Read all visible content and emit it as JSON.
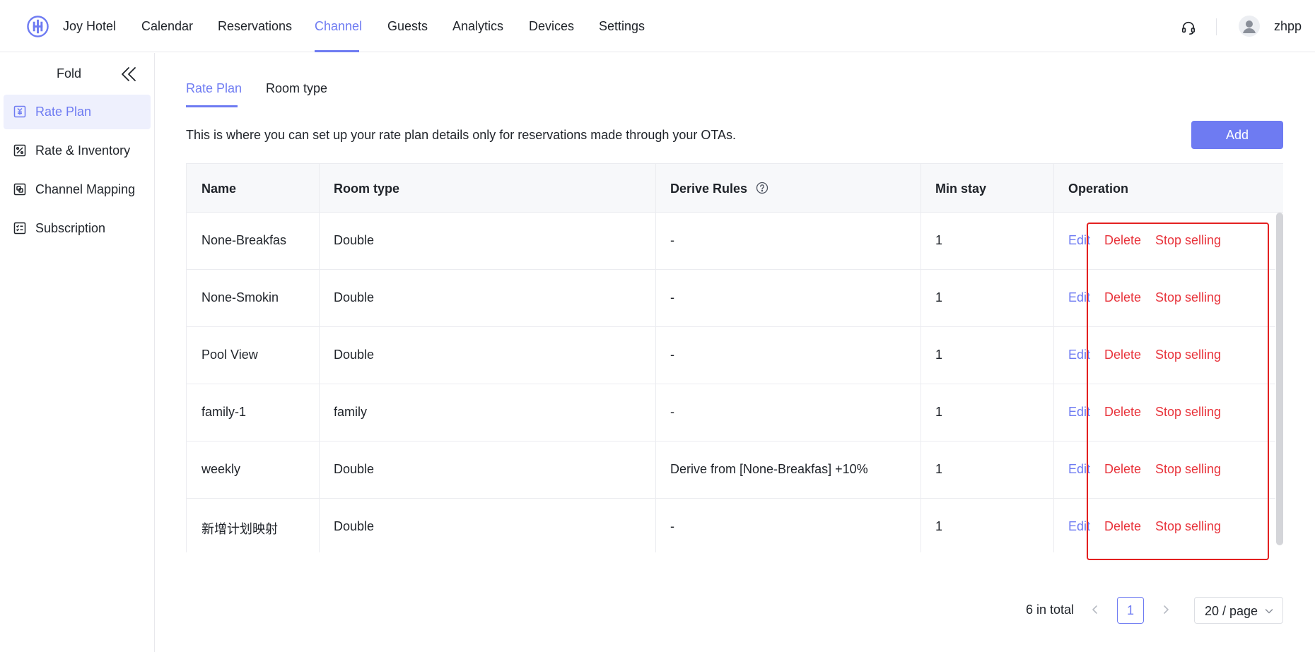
{
  "app": {
    "brand": "Joy Hotel",
    "accent_color": "#6e7bf2",
    "danger_color": "#e8333b",
    "highlight_color": "#e32020"
  },
  "nav": {
    "items": [
      "Calendar",
      "Reservations",
      "Channel",
      "Guests",
      "Analytics",
      "Devices",
      "Settings"
    ],
    "active": "Channel",
    "user": "zhpp"
  },
  "sidebar": {
    "fold_label": "Fold",
    "items": [
      {
        "label": "Rate Plan",
        "icon": "rate-plan-icon",
        "active": true
      },
      {
        "label": "Rate & Inventory",
        "icon": "rate-inventory-icon",
        "active": false
      },
      {
        "label": "Channel Mapping",
        "icon": "channel-mapping-icon",
        "active": false
      },
      {
        "label": "Subscription",
        "icon": "subscription-icon",
        "active": false
      }
    ]
  },
  "main": {
    "tabs": [
      "Rate Plan",
      "Room type"
    ],
    "active_tab": "Rate Plan",
    "description": "This is where you can set up your rate plan details only for reservations made through your OTAs.",
    "add_label": "Add"
  },
  "table": {
    "headers": {
      "name": "Name",
      "room_type": "Room type",
      "derive_rules": "Derive Rules",
      "min_stay": "Min stay",
      "operation": "Operation"
    },
    "rows": [
      {
        "name": "None-Breakfas",
        "room_type": "Double",
        "derive_rules": "-",
        "min_stay": "1",
        "edit": "Edit",
        "delete": "Delete",
        "stop": "Stop selling"
      },
      {
        "name": "None-Smokin",
        "room_type": "Double",
        "derive_rules": "-",
        "min_stay": "1",
        "edit": "Edit",
        "delete": "Delete",
        "stop": "Stop selling"
      },
      {
        "name": "Pool View",
        "room_type": "Double",
        "derive_rules": "-",
        "min_stay": "1",
        "edit": "Edit",
        "delete": "Delete",
        "stop": "Stop selling"
      },
      {
        "name": "family-1",
        "room_type": "family",
        "derive_rules": "-",
        "min_stay": "1",
        "edit": "Edit",
        "delete": "Delete",
        "stop": "Stop selling"
      },
      {
        "name": "weekly",
        "room_type": "Double",
        "derive_rules": "Derive from [None-Breakfas] +10%",
        "min_stay": "1",
        "edit": "Edit",
        "delete": "Delete",
        "stop": "Stop selling"
      },
      {
        "name": "新增计划映射",
        "room_type": "Double",
        "derive_rules": "-",
        "min_stay": "1",
        "edit": "Edit",
        "delete": "Delete",
        "stop": "Stop selling"
      }
    ]
  },
  "pagination": {
    "total": "6 in total",
    "current_page": "1",
    "page_size": "20 / page"
  }
}
